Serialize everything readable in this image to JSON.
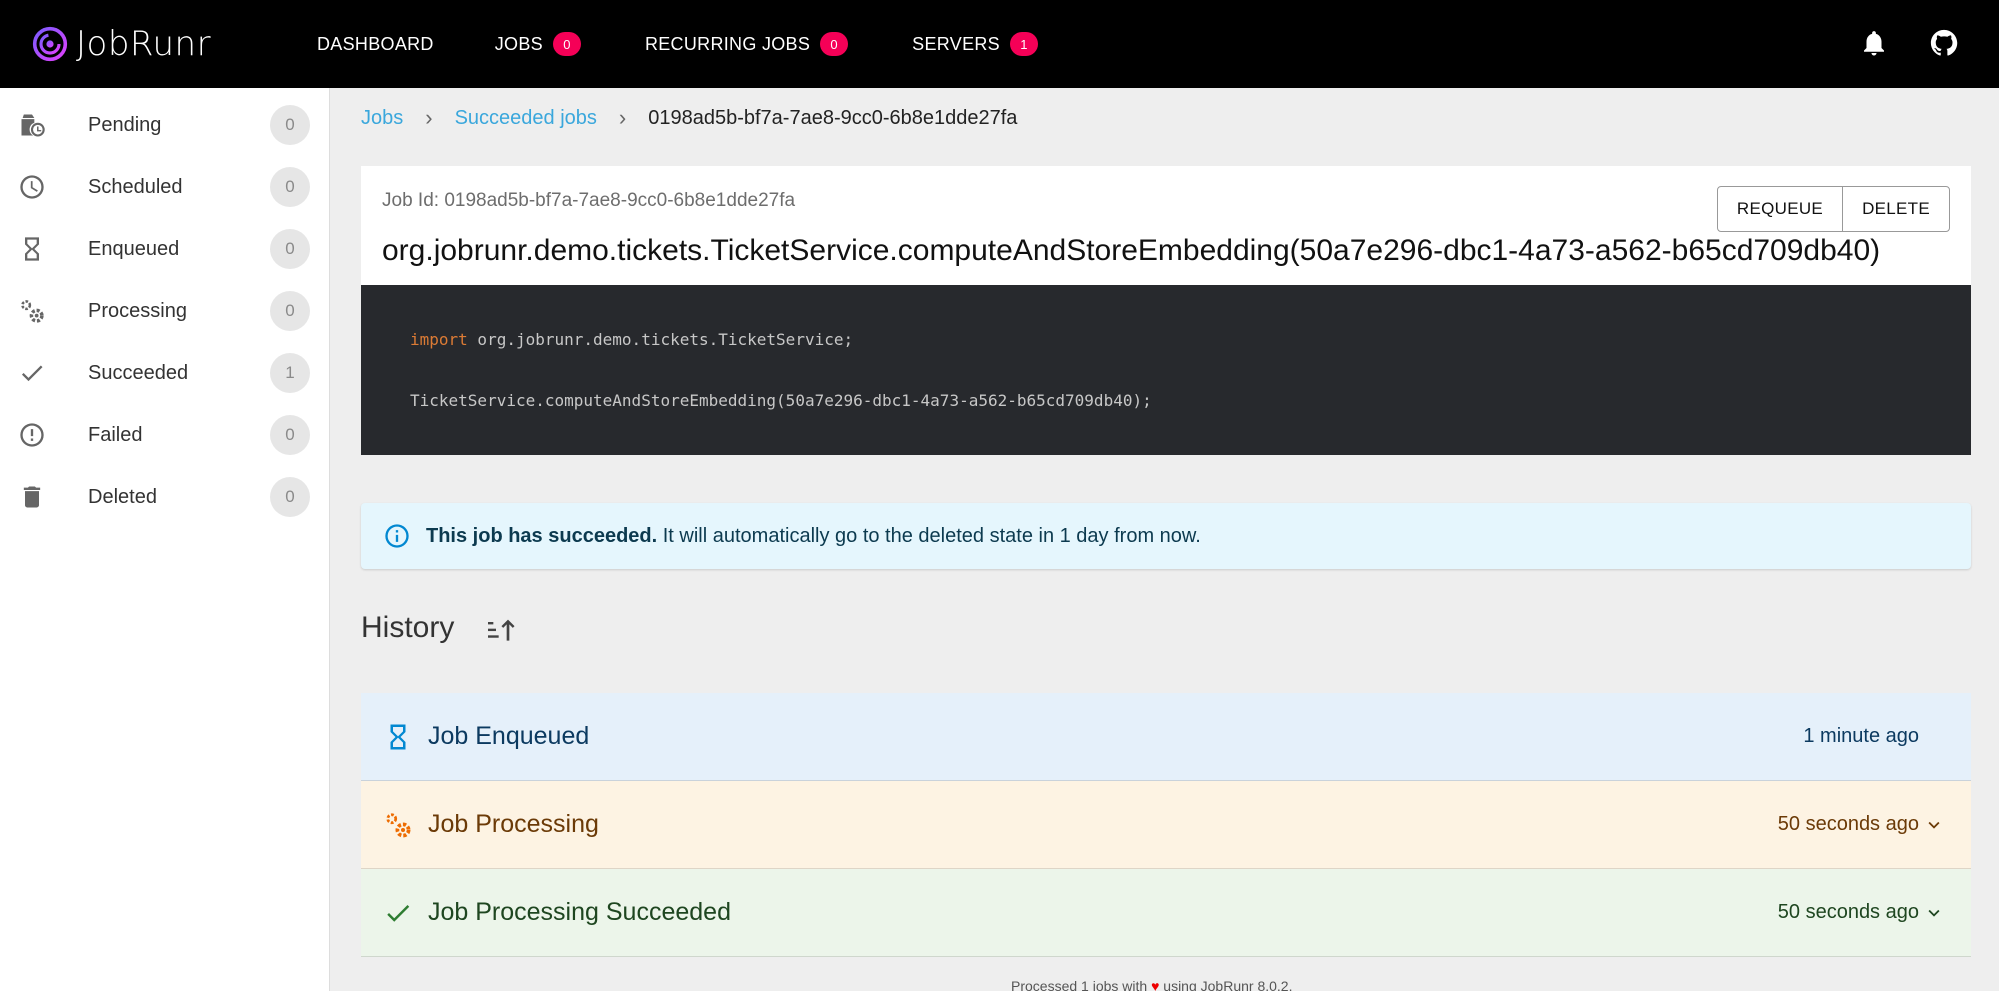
{
  "app": {
    "name": "JobRunr"
  },
  "nav": {
    "dashboard": "DASHBOARD",
    "jobs": "JOBS",
    "jobs_count": "0",
    "recurring": "RECURRING JOBS",
    "recurring_count": "0",
    "servers": "SERVERS",
    "servers_count": "1"
  },
  "sidebar": {
    "items": [
      {
        "label": "Pending",
        "count": "0",
        "icon": "pending-icon"
      },
      {
        "label": "Scheduled",
        "count": "0",
        "icon": "clock-icon"
      },
      {
        "label": "Enqueued",
        "count": "0",
        "icon": "hourglass-icon"
      },
      {
        "label": "Processing",
        "count": "0",
        "icon": "gears-icon"
      },
      {
        "label": "Succeeded",
        "count": "1",
        "icon": "check-icon"
      },
      {
        "label": "Failed",
        "count": "0",
        "icon": "error-icon"
      },
      {
        "label": "Deleted",
        "count": "0",
        "icon": "trash-icon"
      }
    ]
  },
  "breadcrumb": {
    "jobs": "Jobs",
    "succeeded": "Succeeded jobs",
    "current": "0198ad5b-bf7a-7ae8-9cc0-6b8e1dde27fa"
  },
  "job": {
    "id_text": "Job Id: 0198ad5b-bf7a-7ae8-9cc0-6b8e1dde27fa",
    "signature": "org.jobrunr.demo.tickets.TicketService.computeAndStoreEmbedding(50a7e296-dbc1-4a73-a562-b65cd709db40)",
    "requeue": "REQUEUE",
    "delete": "DELETE",
    "code_keyword": "import",
    "code_import": " org.jobrunr.demo.tickets.TicketService;",
    "code_call": "TicketService.computeAndStoreEmbedding(50a7e296-dbc1-4a73-a562-b65cd709db40);"
  },
  "alert": {
    "bold": "This job has succeeded.",
    "text": " It will automatically go to the deleted state in 1 day from now."
  },
  "history": {
    "title": "History",
    "items": [
      {
        "label": "Job Enqueued",
        "time": "1 minute ago"
      },
      {
        "label": "Job Processing",
        "time": "50 seconds ago"
      },
      {
        "label": "Job Processing Succeeded",
        "time": "50 seconds ago"
      }
    ]
  },
  "footer": {
    "prefix": "Processed 1 jobs with ",
    "heart": "♥",
    "suffix": " using JobRunr 8.0.2."
  },
  "colors": {
    "topbar": "#000000",
    "badge": "#f50057",
    "link": "#3aa7dc",
    "code_bg": "#27292d",
    "alert_bg": "#e5f6fd",
    "enqueued_bg": "#e5f0fa",
    "processing_bg": "#fdf3e3",
    "succeeded_bg": "#ecf5ea"
  }
}
